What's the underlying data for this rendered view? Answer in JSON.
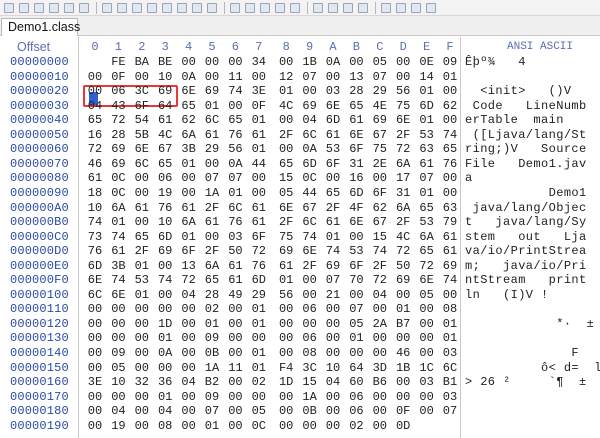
{
  "tab": {
    "label": "Demo1.class"
  },
  "header": {
    "offset_label": "Offset",
    "columns": [
      "0",
      "1",
      "2",
      "3",
      "4",
      "5",
      "6",
      "7",
      "8",
      "9",
      "A",
      "B",
      "C",
      "D",
      "E",
      "F"
    ],
    "ansi_label": "ANSI ASCII"
  },
  "toolbar_icons": [
    "new-file-icon",
    "open-icon",
    "save-icon",
    "print-icon",
    "properties-icon",
    "folder-icon",
    "undo-icon",
    "cut-icon",
    "copy-icon",
    "paste-icon",
    "paste-special-icon",
    "delete-icon",
    "fill-icon",
    "binary-icon",
    "find-icon",
    "find-hex-icon",
    "replace-icon",
    "find-next-icon",
    "goto-offset-icon",
    "goto-back-icon",
    "goto-forward-icon",
    "disk-icon",
    "ram-icon",
    "calculator-icon",
    "hash-icon",
    "tools-icon",
    "help-icon"
  ],
  "rows": [
    {
      "offset": "00000000",
      "bytes": [
        "CA",
        "FE",
        "BA",
        "BE",
        "00",
        "00",
        "00",
        "34",
        "00",
        "1B",
        "0A",
        "00",
        "05",
        "00",
        "0E",
        "09"
      ],
      "ansi": "Êþº¾   4"
    },
    {
      "offset": "00000010",
      "bytes": [
        "00",
        "0F",
        "00",
        "10",
        "0A",
        "00",
        "11",
        "00",
        "12",
        "07",
        "00",
        "13",
        "07",
        "00",
        "14",
        "01"
      ],
      "ansi": ""
    },
    {
      "offset": "00000020",
      "bytes": [
        "00",
        "06",
        "3C",
        "69",
        "6E",
        "69",
        "74",
        "3E",
        "01",
        "00",
        "03",
        "28",
        "29",
        "56",
        "01",
        "00"
      ],
      "ansi": "  <init>   ()V"
    },
    {
      "offset": "00000030",
      "bytes": [
        "04",
        "43",
        "6F",
        "64",
        "65",
        "01",
        "00",
        "0F",
        "4C",
        "69",
        "6E",
        "65",
        "4E",
        "75",
        "6D",
        "62"
      ],
      "ansi": " Code   LineNumb"
    },
    {
      "offset": "00000040",
      "bytes": [
        "65",
        "72",
        "54",
        "61",
        "62",
        "6C",
        "65",
        "01",
        "00",
        "04",
        "6D",
        "61",
        "69",
        "6E",
        "01",
        "00"
      ],
      "ansi": "erTable  main"
    },
    {
      "offset": "00000050",
      "bytes": [
        "16",
        "28",
        "5B",
        "4C",
        "6A",
        "61",
        "76",
        "61",
        "2F",
        "6C",
        "61",
        "6E",
        "67",
        "2F",
        "53",
        "74"
      ],
      "ansi": " ([Ljava/lang/St"
    },
    {
      "offset": "00000060",
      "bytes": [
        "72",
        "69",
        "6E",
        "67",
        "3B",
        "29",
        "56",
        "01",
        "00",
        "0A",
        "53",
        "6F",
        "75",
        "72",
        "63",
        "65"
      ],
      "ansi": "ring;)V   Source"
    },
    {
      "offset": "00000070",
      "bytes": [
        "46",
        "69",
        "6C",
        "65",
        "01",
        "00",
        "0A",
        "44",
        "65",
        "6D",
        "6F",
        "31",
        "2E",
        "6A",
        "61",
        "76"
      ],
      "ansi": "File   Demo1.jav"
    },
    {
      "offset": "00000080",
      "bytes": [
        "61",
        "0C",
        "00",
        "06",
        "00",
        "07",
        "07",
        "00",
        "15",
        "0C",
        "00",
        "16",
        "00",
        "17",
        "07",
        "00"
      ],
      "ansi": "a"
    },
    {
      "offset": "00000090",
      "bytes": [
        "18",
        "0C",
        "00",
        "19",
        "00",
        "1A",
        "01",
        "00",
        "05",
        "44",
        "65",
        "6D",
        "6F",
        "31",
        "01",
        "00"
      ],
      "ansi": "           Demo1"
    },
    {
      "offset": "000000A0",
      "bytes": [
        "10",
        "6A",
        "61",
        "76",
        "61",
        "2F",
        "6C",
        "61",
        "6E",
        "67",
        "2F",
        "4F",
        "62",
        "6A",
        "65",
        "63"
      ],
      "ansi": " java/lang/Objec"
    },
    {
      "offset": "000000B0",
      "bytes": [
        "74",
        "01",
        "00",
        "10",
        "6A",
        "61",
        "76",
        "61",
        "2F",
        "6C",
        "61",
        "6E",
        "67",
        "2F",
        "53",
        "79"
      ],
      "ansi": "t   java/lang/Sy"
    },
    {
      "offset": "000000C0",
      "bytes": [
        "73",
        "74",
        "65",
        "6D",
        "01",
        "00",
        "03",
        "6F",
        "75",
        "74",
        "01",
        "00",
        "15",
        "4C",
        "6A",
        "61"
      ],
      "ansi": "stem   out   Lja"
    },
    {
      "offset": "000000D0",
      "bytes": [
        "76",
        "61",
        "2F",
        "69",
        "6F",
        "2F",
        "50",
        "72",
        "69",
        "6E",
        "74",
        "53",
        "74",
        "72",
        "65",
        "61"
      ],
      "ansi": "va/io/PrintStrea"
    },
    {
      "offset": "000000E0",
      "bytes": [
        "6D",
        "3B",
        "01",
        "00",
        "13",
        "6A",
        "61",
        "76",
        "61",
        "2F",
        "69",
        "6F",
        "2F",
        "50",
        "72",
        "69"
      ],
      "ansi": "m;   java/io/Pri"
    },
    {
      "offset": "000000F0",
      "bytes": [
        "6E",
        "74",
        "53",
        "74",
        "72",
        "65",
        "61",
        "6D",
        "01",
        "00",
        "07",
        "70",
        "72",
        "69",
        "6E",
        "74"
      ],
      "ansi": "ntStream   print"
    },
    {
      "offset": "00000100",
      "bytes": [
        "6C",
        "6E",
        "01",
        "00",
        "04",
        "28",
        "49",
        "29",
        "56",
        "00",
        "21",
        "00",
        "04",
        "00",
        "05",
        "00"
      ],
      "ansi": "ln   (I)V !"
    },
    {
      "offset": "00000110",
      "bytes": [
        "00",
        "00",
        "00",
        "00",
        "00",
        "02",
        "00",
        "01",
        "00",
        "06",
        "00",
        "07",
        "00",
        "01",
        "00",
        "08"
      ],
      "ansi": ""
    },
    {
      "offset": "00000120",
      "bytes": [
        "00",
        "00",
        "00",
        "1D",
        "00",
        "01",
        "00",
        "01",
        "00",
        "00",
        "00",
        "05",
        "2A",
        "B7",
        "00",
        "01",
        "B1"
      ],
      "ansi": "            *·  ±"
    },
    {
      "offset": "00000130",
      "bytes": [
        "00",
        "00",
        "00",
        "01",
        "00",
        "09",
        "00",
        "00",
        "00",
        "06",
        "00",
        "01",
        "00",
        "00",
        "00",
        "01"
      ],
      "ansi": ""
    },
    {
      "offset": "00000140",
      "bytes": [
        "00",
        "09",
        "00",
        "0A",
        "00",
        "0B",
        "00",
        "01",
        "00",
        "08",
        "00",
        "00",
        "00",
        "46",
        "00",
        "03"
      ],
      "ansi": "              F"
    },
    {
      "offset": "00000150",
      "bytes": [
        "00",
        "05",
        "00",
        "00",
        "00",
        "1A",
        "11",
        "01",
        "F4",
        "3C",
        "10",
        "64",
        "3D",
        "1B",
        "1C",
        "6C"
      ],
      "ansi": "          ô< d=  l"
    },
    {
      "offset": "00000160",
      "bytes": [
        "3E",
        "10",
        "32",
        "36",
        "04",
        "B2",
        "00",
        "02",
        "1D",
        "15",
        "04",
        "60",
        "B6",
        "00",
        "03",
        "B1"
      ],
      "ansi": "> 26 ²     `¶  ±"
    },
    {
      "offset": "00000170",
      "bytes": [
        "00",
        "00",
        "00",
        "01",
        "00",
        "09",
        "00",
        "00",
        "00",
        "1A",
        "00",
        "06",
        "00",
        "00",
        "00",
        "03"
      ],
      "ansi": ""
    },
    {
      "offset": "00000180",
      "bytes": [
        "00",
        "04",
        "00",
        "04",
        "00",
        "07",
        "00",
        "05",
        "00",
        "0B",
        "00",
        "06",
        "00",
        "0F",
        "00",
        "07"
      ],
      "ansi": ""
    },
    {
      "offset": "00000190",
      "bytes": [
        "00",
        "19",
        "00",
        "08",
        "00",
        "01",
        "00",
        "0C",
        "00",
        "00",
        "00",
        "02",
        "00",
        "0D"
      ],
      "ansi": ""
    }
  ]
}
